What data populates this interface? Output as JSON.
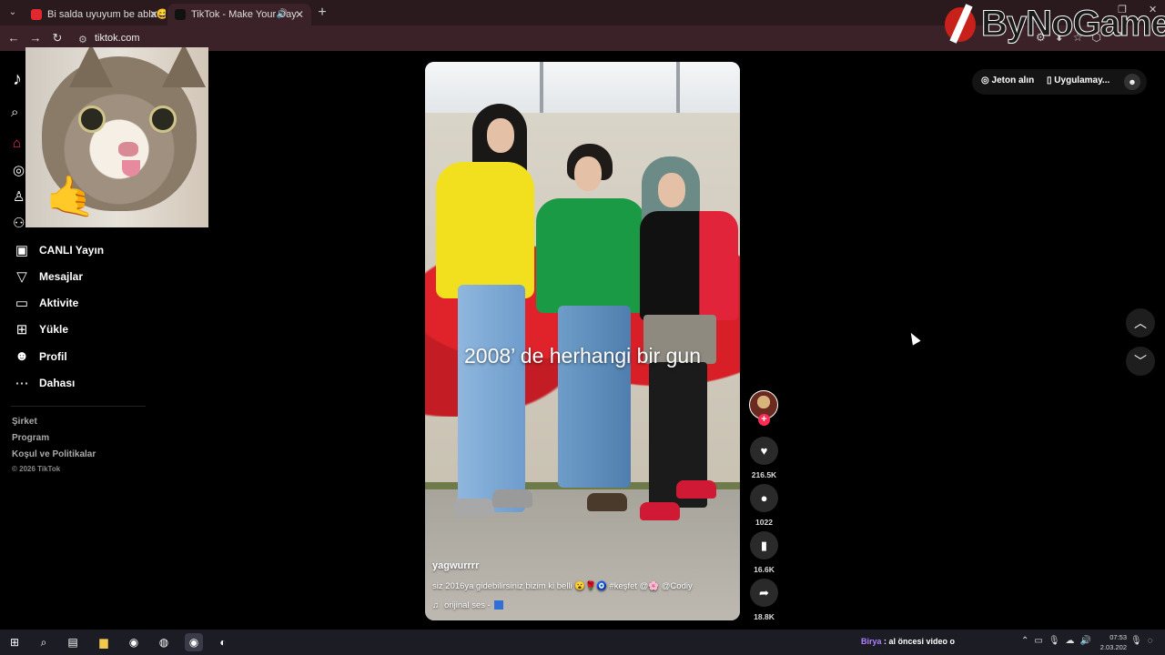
{
  "browser": {
    "tabs": [
      {
        "title": "Bi salda uyuyum be abla😄 - Yo",
        "active": false,
        "favicon_color": "#e0282e"
      },
      {
        "title": "TikTok - Make Your Day",
        "active": true,
        "favicon_color": "#111111"
      }
    ],
    "new_tab_label": "+",
    "url": "tiktok.com"
  },
  "watermark": {
    "text": "ByNoGame"
  },
  "sidebar": {
    "nav": [
      {
        "label": "CANLI Yayın",
        "icon": "live-icon"
      },
      {
        "label": "Mesajlar",
        "icon": "messages-icon"
      },
      {
        "label": "Aktivite",
        "icon": "activity-icon"
      },
      {
        "label": "Yükle",
        "icon": "upload-icon"
      },
      {
        "label": "Profil",
        "icon": "profile-icon"
      },
      {
        "label": "Dahası",
        "icon": "more-icon"
      }
    ],
    "footer": [
      "Şirket",
      "Program",
      "Koşul ve Politikalar"
    ],
    "copyright": "© 2026 TikTok"
  },
  "header_right": {
    "coins_label": "Jeton alın",
    "app_label": "Uygulamay..."
  },
  "video": {
    "overlay_text": "2008’ de herhangi bir gun",
    "author": "yagwurrrr",
    "description": "siz 2016ya gidebilirsiniz bizim ki belli 😮🌹🧿 #keşfet @🌸 @Codiy",
    "sound": "orijinal ses -",
    "likes": "216.5K",
    "comments": "1022",
    "saves": "16.6K",
    "shares": "18.8K"
  },
  "taskbar": {
    "stream_user": "Birya",
    "stream_message": ": al öncesi video o",
    "time": "07:53",
    "date": "2.03.202"
  },
  "colors": {
    "accent": "#fe2c55",
    "tab_bar": "#2a1a1e",
    "address_bar": "#3b2228"
  }
}
